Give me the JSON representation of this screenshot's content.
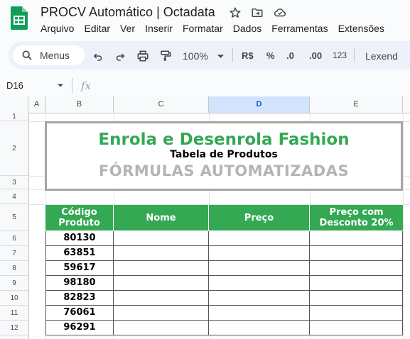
{
  "document": {
    "title": "PROCV Automático | Octadata"
  },
  "menu": [
    "Arquivo",
    "Editar",
    "Ver",
    "Inserir",
    "Formatar",
    "Dados",
    "Ferramentas",
    "Extensões"
  ],
  "toolbar": {
    "search_label": "Menus",
    "zoom": "100%",
    "currency": "R$",
    "percent": "%",
    "decrease_decimal": ".0",
    "increase_decimal": ".00",
    "number_format": "123",
    "font": "Lexend"
  },
  "formula_bar": {
    "cell_ref": "D16",
    "fx": "fx"
  },
  "columns": [
    "A",
    "B",
    "C",
    "D",
    "E"
  ],
  "selected_column": "D",
  "rows": [
    "1",
    "2",
    "3",
    "4",
    "5",
    "6",
    "7",
    "8",
    "9",
    "10",
    "11",
    "12"
  ],
  "banner": {
    "title": "Enrola e Desenrola Fashion",
    "subtitle": "Tabela de Produtos",
    "formula_text": "FÓRMULAS AUTOMATIZADAS"
  },
  "table": {
    "headers": {
      "code_line1": "Código",
      "code_line2": "Produto",
      "name": "Nome",
      "price": "Preço",
      "discount_line1": "Preço com",
      "discount_line2": "Desconto 20%"
    },
    "codes": [
      "80130",
      "63851",
      "59617",
      "98180",
      "82823",
      "76061",
      "96291"
    ]
  },
  "colors": {
    "accent_green": "#34a853",
    "selected_column": "#d3e3fd",
    "banner_border": "#a5a5a5"
  }
}
